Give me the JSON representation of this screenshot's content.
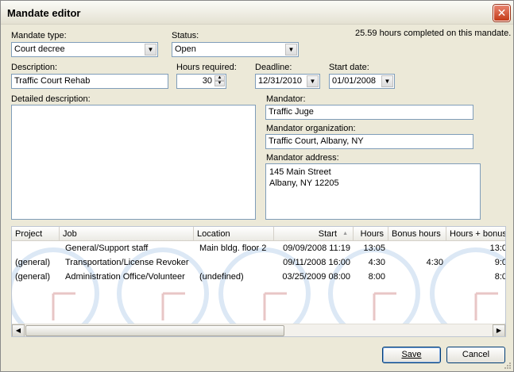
{
  "window": {
    "title": "Mandate editor",
    "close_glyph": "✕"
  },
  "summary": "25.59 hours completed on this mandate.",
  "form": {
    "mandate_type_label": "Mandate type:",
    "mandate_type_value": "Court decree",
    "status_label": "Status:",
    "status_value": "Open",
    "description_label": "Description:",
    "description_value": "Traffic Court Rehab",
    "hours_required_label": "Hours required:",
    "hours_required_value": "30",
    "deadline_label": "Deadline:",
    "deadline_value": "12/31/2010",
    "start_date_label": "Start date:",
    "start_date_value": "01/01/2008",
    "detailed_description_label": "Detailed description:",
    "detailed_description_value": "",
    "mandator_label": "Mandator:",
    "mandator_value": "Traffic Juge",
    "mandator_org_label": "Mandator organization:",
    "mandator_org_value": "Traffic Court, Albany, NY",
    "mandator_address_label": "Mandator address:",
    "mandator_address_value": "145 Main Street\nAlbany, NY 12205"
  },
  "grid": {
    "columns": {
      "project": "Project",
      "job": "Job",
      "location": "Location",
      "start": "Start",
      "hours": "Hours",
      "bonus_hours": "Bonus hours",
      "hours_plus_bonus": "Hours + bonus"
    },
    "sort_glyph": "▲",
    "rows": [
      {
        "project": "",
        "job": "General/Support staff",
        "location": "Main bldg. floor 2",
        "start": "09/09/2008 11:19",
        "hours": "13:05",
        "bonus_hours": "",
        "hours_plus_bonus": "13:0"
      },
      {
        "project": "(general)",
        "job": "Transportation/License Revoker",
        "location": "",
        "start": "09/11/2008 16:00",
        "hours": "4:30",
        "bonus_hours": "4:30",
        "hours_plus_bonus": "9:0"
      },
      {
        "project": "(general)",
        "job": "Administration Office/Volunteer",
        "location": "(undefined)",
        "start": "03/25/2009 08:00",
        "hours": "8:00",
        "bonus_hours": "",
        "hours_plus_bonus": "8:0"
      }
    ]
  },
  "buttons": {
    "save": "Save",
    "cancel": "Cancel"
  },
  "icons": {
    "dropdown": "chevron-down-icon",
    "spin_up": "▲",
    "spin_down": "▼",
    "scroll_left": "◀",
    "scroll_right": "▶",
    "watermark": "clock-icon"
  },
  "colors": {
    "dialog_bg": "#ECE9D8",
    "field_border": "#7F9DB9",
    "close_red": "#C43A18",
    "button_border": "#003C74",
    "clock_watermark": "#DCE8F5"
  }
}
